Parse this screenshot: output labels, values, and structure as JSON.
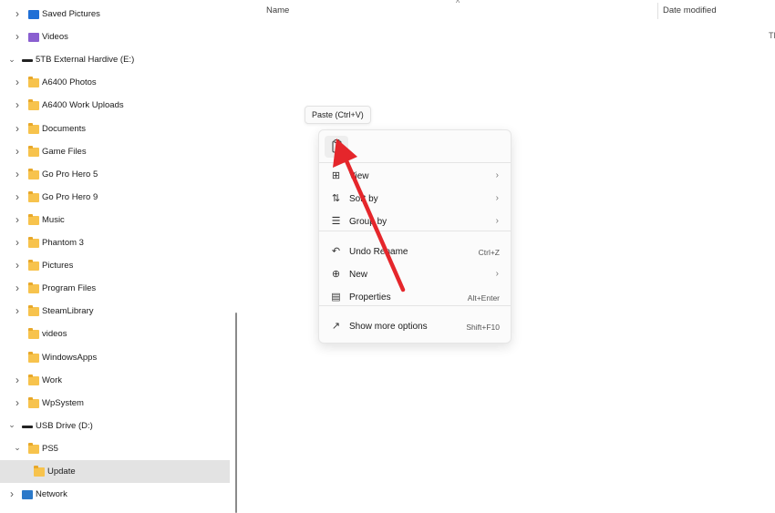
{
  "sidebar": {
    "items": [
      {
        "label": "Saved Pictures",
        "icon": "pictures-icon",
        "chevron": true
      },
      {
        "label": "Videos",
        "icon": "videos-icon",
        "chevron": true
      },
      {
        "label": "5TB External Hardive (E:)",
        "icon": "drive-icon",
        "chevron": true,
        "expanded": true
      },
      {
        "label": "A6400 Photos",
        "icon": "folder-icon",
        "chevron": true
      },
      {
        "label": "A6400 Work Uploads",
        "icon": "folder-icon",
        "chevron": true
      },
      {
        "label": "Documents",
        "icon": "folder-icon",
        "chevron": true
      },
      {
        "label": "Game Files",
        "icon": "folder-icon",
        "chevron": true
      },
      {
        "label": "Go Pro Hero 5",
        "icon": "folder-icon",
        "chevron": true
      },
      {
        "label": "Go Pro Hero 9",
        "icon": "folder-icon",
        "chevron": true
      },
      {
        "label": "Music",
        "icon": "folder-icon",
        "chevron": true
      },
      {
        "label": "Phantom 3",
        "icon": "folder-icon",
        "chevron": true
      },
      {
        "label": "Pictures",
        "icon": "folder-icon",
        "chevron": true
      },
      {
        "label": "Program Files",
        "icon": "folder-icon",
        "chevron": true
      },
      {
        "label": "SteamLibrary",
        "icon": "folder-icon",
        "chevron": true
      },
      {
        "label": "videos",
        "icon": "folder-icon",
        "chevron": false
      },
      {
        "label": "WindowsApps",
        "icon": "folder-icon",
        "chevron": false
      },
      {
        "label": "Work",
        "icon": "folder-icon",
        "chevron": true
      },
      {
        "label": "WpSystem",
        "icon": "folder-icon",
        "chevron": true
      },
      {
        "label": "USB Drive (D:)",
        "icon": "drive-icon",
        "chevron": true,
        "expanded": true
      },
      {
        "label": "PS5",
        "icon": "folder-icon",
        "chevron": true,
        "expanded": true
      },
      {
        "label": "Update",
        "icon": "folder-icon",
        "chevron": false,
        "selected": true
      },
      {
        "label": "Network",
        "icon": "network-icon",
        "chevron": true
      }
    ]
  },
  "columns": {
    "name": "Name",
    "date_modified": "Date modified",
    "truncated": "Tl"
  },
  "tooltip": "Paste (Ctrl+V)",
  "context_menu": {
    "paste_icon": "clipboard-icon",
    "items": [
      {
        "label": "View",
        "icon": "grid-icon",
        "submenu": true
      },
      {
        "label": "Sort by",
        "icon": "sort-icon",
        "submenu": true
      },
      {
        "label": "Group by",
        "icon": "group-icon",
        "submenu": true
      },
      {
        "label": "Undo Rename",
        "icon": "undo-icon",
        "shortcut": "Ctrl+Z"
      },
      {
        "label": "New",
        "icon": "plus-circle-icon",
        "submenu": true
      },
      {
        "label": "Properties",
        "icon": "properties-icon",
        "shortcut": "Alt+Enter"
      },
      {
        "label": "Show more options",
        "icon": "more-options-icon",
        "shortcut": "Shift+F10"
      }
    ]
  },
  "colors": {
    "folder": "#f7c34d",
    "selected_row": "#e3e3e3",
    "arrow": "#e5262b"
  }
}
